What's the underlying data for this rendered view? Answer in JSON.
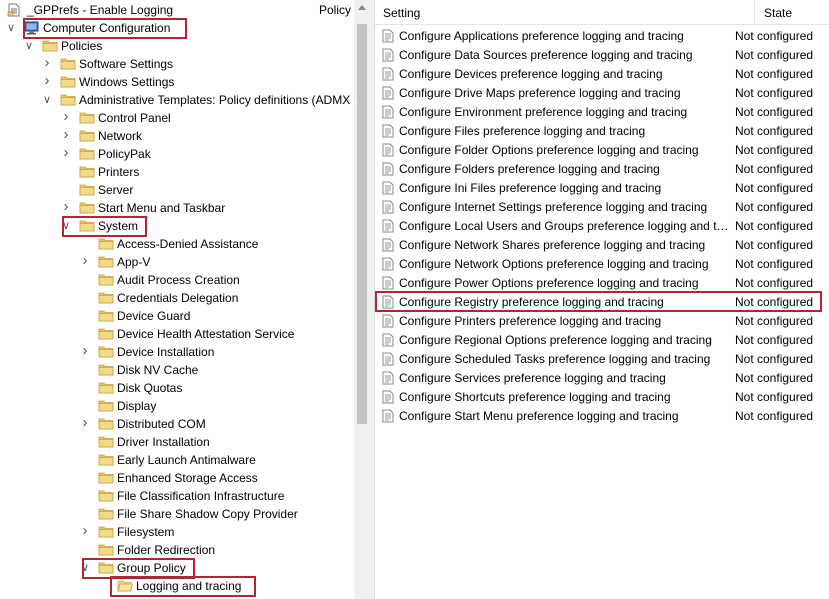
{
  "tree": {
    "gpo_title": "_GPPrefs - Enable Logging",
    "policy_column": "Policy",
    "items": [
      {
        "label": "Computer Configuration",
        "twisty": "expanded",
        "icon": "computer-icon",
        "level": 0
      },
      {
        "label": "Policies",
        "twisty": "expanded",
        "icon": "folder-icon",
        "level": 1
      },
      {
        "label": "Software Settings",
        "twisty": "collapsed",
        "icon": "folder-icon",
        "level": 2
      },
      {
        "label": "Windows Settings",
        "twisty": "collapsed",
        "icon": "folder-icon",
        "level": 2
      },
      {
        "label": "Administrative Templates: Policy definitions (ADMX files)",
        "twisty": "expanded",
        "icon": "folder-icon",
        "level": 2
      },
      {
        "label": "Control Panel",
        "twisty": "collapsed",
        "icon": "folder-icon",
        "level": 3
      },
      {
        "label": "Network",
        "twisty": "collapsed",
        "icon": "folder-icon",
        "level": 3
      },
      {
        "label": "PolicyPak",
        "twisty": "collapsed",
        "icon": "folder-icon",
        "level": 3
      },
      {
        "label": "Printers",
        "twisty": "none",
        "icon": "folder-icon",
        "level": 3
      },
      {
        "label": "Server",
        "twisty": "none",
        "icon": "folder-icon",
        "level": 3
      },
      {
        "label": "Start Menu and Taskbar",
        "twisty": "collapsed",
        "icon": "folder-icon",
        "level": 3
      },
      {
        "label": "System",
        "twisty": "expanded",
        "icon": "folder-icon",
        "level": 3
      },
      {
        "label": "Access-Denied Assistance",
        "twisty": "none",
        "icon": "folder-icon",
        "level": 4
      },
      {
        "label": "App-V",
        "twisty": "collapsed",
        "icon": "folder-icon",
        "level": 4
      },
      {
        "label": "Audit Process Creation",
        "twisty": "none",
        "icon": "folder-icon",
        "level": 4
      },
      {
        "label": "Credentials Delegation",
        "twisty": "none",
        "icon": "folder-icon",
        "level": 4
      },
      {
        "label": "Device Guard",
        "twisty": "none",
        "icon": "folder-icon",
        "level": 4
      },
      {
        "label": "Device Health Attestation Service",
        "twisty": "none",
        "icon": "folder-icon",
        "level": 4
      },
      {
        "label": "Device Installation",
        "twisty": "collapsed",
        "icon": "folder-icon",
        "level": 4
      },
      {
        "label": "Disk NV Cache",
        "twisty": "none",
        "icon": "folder-icon",
        "level": 4
      },
      {
        "label": "Disk Quotas",
        "twisty": "none",
        "icon": "folder-icon",
        "level": 4
      },
      {
        "label": "Display",
        "twisty": "none",
        "icon": "folder-icon",
        "level": 4
      },
      {
        "label": "Distributed COM",
        "twisty": "collapsed",
        "icon": "folder-icon",
        "level": 4
      },
      {
        "label": "Driver Installation",
        "twisty": "none",
        "icon": "folder-icon",
        "level": 4
      },
      {
        "label": "Early Launch Antimalware",
        "twisty": "none",
        "icon": "folder-icon",
        "level": 4
      },
      {
        "label": "Enhanced Storage Access",
        "twisty": "none",
        "icon": "folder-icon",
        "level": 4
      },
      {
        "label": "File Classification Infrastructure",
        "twisty": "none",
        "icon": "folder-icon",
        "level": 4
      },
      {
        "label": "File Share Shadow Copy Provider",
        "twisty": "none",
        "icon": "folder-icon",
        "level": 4
      },
      {
        "label": "Filesystem",
        "twisty": "collapsed",
        "icon": "folder-icon",
        "level": 4
      },
      {
        "label": "Folder Redirection",
        "twisty": "none",
        "icon": "folder-icon",
        "level": 4
      },
      {
        "label": "Group Policy",
        "twisty": "expanded",
        "icon": "folder-icon",
        "level": 4
      },
      {
        "label": "Logging and tracing",
        "twisty": "none",
        "icon": "folder-open-icon",
        "level": 5
      }
    ]
  },
  "list": {
    "columns": {
      "setting": "Setting",
      "state": "State"
    },
    "rows": [
      {
        "setting": "Configure Applications preference logging and tracing",
        "state": "Not configured"
      },
      {
        "setting": "Configure Data Sources preference logging and tracing",
        "state": "Not configured"
      },
      {
        "setting": "Configure Devices preference logging and tracing",
        "state": "Not configured"
      },
      {
        "setting": "Configure Drive Maps preference logging and tracing",
        "state": "Not configured"
      },
      {
        "setting": "Configure Environment preference logging and tracing",
        "state": "Not configured"
      },
      {
        "setting": "Configure Files preference logging and tracing",
        "state": "Not configured"
      },
      {
        "setting": "Configure Folder Options preference logging and tracing",
        "state": "Not configured"
      },
      {
        "setting": "Configure Folders preference logging and tracing",
        "state": "Not configured"
      },
      {
        "setting": "Configure Ini Files preference logging and tracing",
        "state": "Not configured"
      },
      {
        "setting": "Configure Internet Settings preference logging and tracing",
        "state": "Not configured"
      },
      {
        "setting": "Configure Local Users and Groups preference logging and tracing",
        "state": "Not configured"
      },
      {
        "setting": "Configure Network Shares preference logging and tracing",
        "state": "Not configured"
      },
      {
        "setting": "Configure Network Options preference logging and tracing",
        "state": "Not configured"
      },
      {
        "setting": "Configure Power Options preference logging and tracing",
        "state": "Not configured"
      },
      {
        "setting": "Configure Registry preference logging and tracing",
        "state": "Not configured"
      },
      {
        "setting": "Configure Printers preference logging and tracing",
        "state": "Not configured"
      },
      {
        "setting": "Configure Regional Options preference logging and tracing",
        "state": "Not configured"
      },
      {
        "setting": "Configure Scheduled Tasks preference logging and tracing",
        "state": "Not configured"
      },
      {
        "setting": "Configure Services preference logging and tracing",
        "state": "Not configured"
      },
      {
        "setting": "Configure Shortcuts preference logging and tracing",
        "state": "Not configured"
      },
      {
        "setting": "Configure Start Menu preference logging and tracing",
        "state": "Not configured"
      }
    ]
  },
  "colors": {
    "highlight": "#b32434",
    "folder": "#e8c565",
    "folder_dark": "#d4a93c"
  }
}
